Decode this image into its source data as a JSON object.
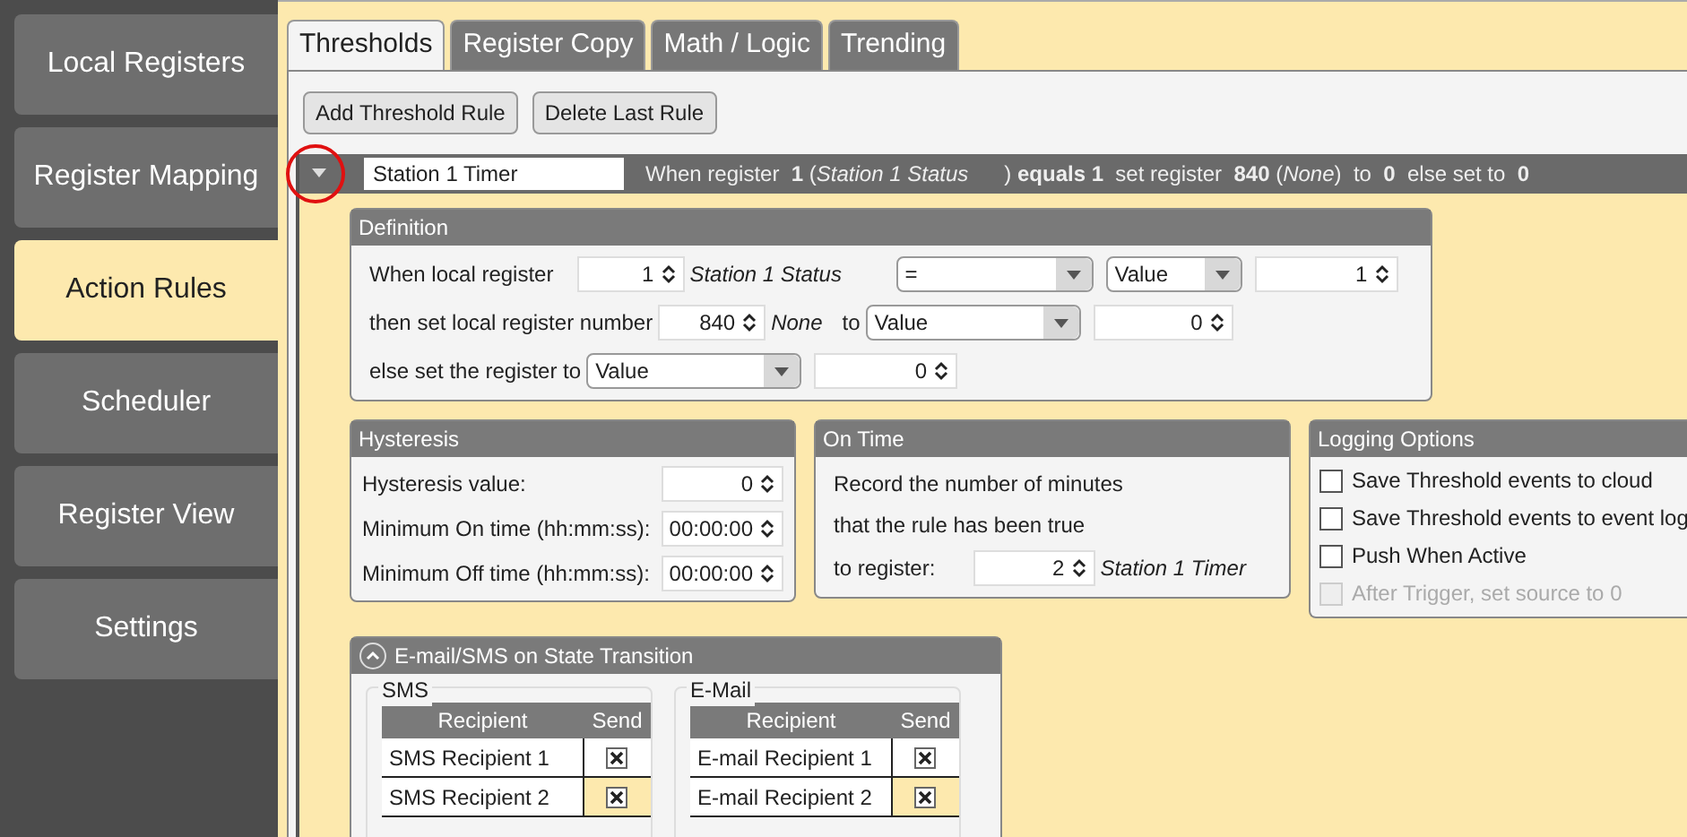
{
  "sidebar": {
    "items": [
      {
        "label": "Local Registers",
        "selected": false
      },
      {
        "label": "Register Mapping",
        "selected": false
      },
      {
        "label": "Action Rules",
        "selected": true
      },
      {
        "label": "Scheduler",
        "selected": false
      },
      {
        "label": "Register View",
        "selected": false
      },
      {
        "label": "Settings",
        "selected": false
      }
    ]
  },
  "tabs": [
    {
      "label": "Thresholds",
      "selected": true
    },
    {
      "label": "Register Copy",
      "selected": false
    },
    {
      "label": "Math / Logic",
      "selected": false
    },
    {
      "label": "Trending",
      "selected": false
    }
  ],
  "toolbar": {
    "buttons": [
      "Add Threshold Rule",
      "Delete Last Rule"
    ]
  },
  "rule": {
    "name": "Station 1 Timer",
    "summary": "When register  **1** (*Station 1 Status*      ) **equals 1**  set register  **840** (*None*)  to  **0**  else set to  **0**"
  },
  "definition": {
    "title": "Definition",
    "rows": [
      {
        "items": [
          {
            "kind": "label",
            "text": "When local register"
          },
          {
            "kind": "spinner",
            "value": "1"
          },
          {
            "kind": "note",
            "text": "Station 1 Status"
          },
          {
            "kind": "select",
            "value": "="
          },
          {
            "kind": "select",
            "value": "Value"
          },
          {
            "kind": "spinner",
            "value": "1"
          }
        ]
      },
      {
        "items": [
          {
            "kind": "label",
            "text": "then set local register number"
          },
          {
            "kind": "spinner",
            "value": "840"
          },
          {
            "kind": "note",
            "text": "None"
          },
          {
            "kind": "label",
            "text": "to"
          },
          {
            "kind": "select",
            "value": "Value"
          },
          {
            "kind": "spinner",
            "value": "0"
          }
        ]
      },
      {
        "items": [
          {
            "kind": "label",
            "text": "else set the register to"
          },
          {
            "kind": "select",
            "value": "Value"
          },
          {
            "kind": "spinner",
            "value": "0"
          }
        ]
      }
    ]
  },
  "hysteresis": {
    "title": "Hysteresis",
    "rows": [
      {
        "label": "Hysteresis value:",
        "value": "0"
      },
      {
        "label": "Minimum On time (hh:mm:ss):",
        "value": "00:00:00"
      },
      {
        "label": "Minimum Off time (hh:mm:ss):",
        "value": "00:00:00"
      }
    ]
  },
  "on_time": {
    "title": "On Time",
    "lines": [
      "Record the number of minutes",
      "that the rule has been true"
    ],
    "register_label": "to register:",
    "register_value": "2",
    "register_name": "Station 1 Timer"
  },
  "logging": {
    "title": "Logging Options",
    "options": [
      {
        "label": "Save Threshold events to cloud",
        "checked": false,
        "disabled": false
      },
      {
        "label": "Save Threshold events to event log",
        "checked": false,
        "disabled": false
      },
      {
        "label": "Push When Active",
        "checked": false,
        "disabled": false
      },
      {
        "label": "After Trigger, set source to 0",
        "checked": false,
        "disabled": true
      }
    ]
  },
  "notifications": {
    "title": "E-mail/SMS on State Transition",
    "groups": [
      {
        "title": "SMS",
        "columns": [
          "Recipient",
          "Send"
        ],
        "rows": [
          {
            "recipient": "SMS Recipient 1",
            "send": true,
            "selected": false
          },
          {
            "recipient": "SMS Recipient 2",
            "send": true,
            "selected": true
          }
        ]
      },
      {
        "title": "E-Mail",
        "columns": [
          "Recipient",
          "Send"
        ],
        "rows": [
          {
            "recipient": "E-mail Recipient 1",
            "send": true,
            "selected": false
          },
          {
            "recipient": "E-mail Recipient 2",
            "send": true,
            "selected": true
          }
        ]
      }
    ]
  }
}
